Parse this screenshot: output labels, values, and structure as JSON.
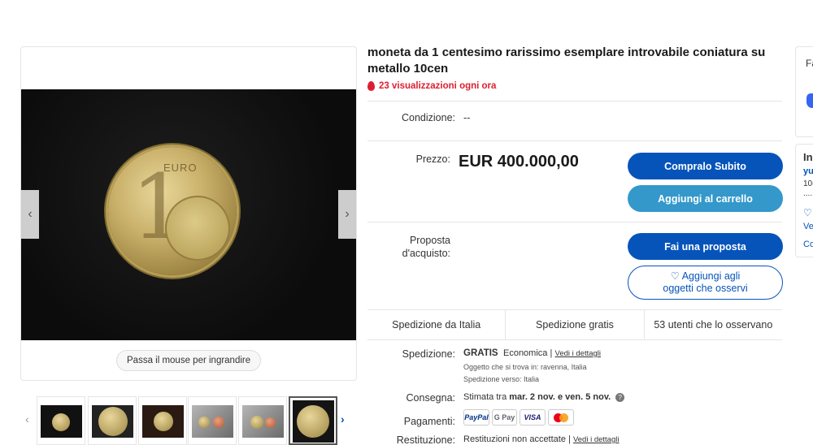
{
  "listing": {
    "title": "moneta da 1 centesimo rarissimo esemplare introvabile coniatura su metallo 10cen",
    "views": "23 visualizzazioni ogni ora"
  },
  "gallery": {
    "hover_hint": "Passa il mouse per ingrandire",
    "thumbnail_count": 6
  },
  "details": {
    "condition_label": "Condizione:",
    "condition_value": "--",
    "price_label": "Prezzo:",
    "price_value": "EUR 400.000,00",
    "offer_label": "Proposta d'acquisto:"
  },
  "buttons": {
    "buy_now": "Compralo Subito",
    "add_to_cart": "Aggiungi al carrello",
    "make_offer": "Fai una proposta",
    "watch": "Aggiungi agli oggetti che osservi",
    "heart": "♡"
  },
  "shipping_strip": [
    "Spedizione da Italia",
    "Spedizione gratis",
    "53 utenti che lo osservano"
  ],
  "shipping": {
    "label": "Spedizione:",
    "free": "GRATIS",
    "method": "Economica |",
    "details_link": "Vedi i dettagli",
    "location": "Oggetto che si trova in:  ravenna, Italia",
    "ships_to": "Spedizione verso:  Italia"
  },
  "delivery": {
    "label": "Consegna:",
    "prefix": "Stimata tra",
    "range": "mar. 2 nov. e ven. 5 nov.",
    "info": "?"
  },
  "payments": {
    "label": "Pagamenti:",
    "methods": [
      "PayPal",
      "G Pay",
      "VISA",
      "Mastercard"
    ]
  },
  "returns": {
    "label": "Restituzione:",
    "value": "Restituzioni non accettate |",
    "details_link": "Vedi i dettagli"
  },
  "side": {
    "top_letter": "Fa",
    "mid_title": "In",
    "mid_user": "yu",
    "mid_num": "10(",
    "mid_dots": "....",
    "mid_link1": "Ve",
    "mid_link2": "Co"
  },
  "colors": {
    "accent": "#0654ba",
    "secondary_button": "#3498ca",
    "views_red": "#dd1e31"
  }
}
